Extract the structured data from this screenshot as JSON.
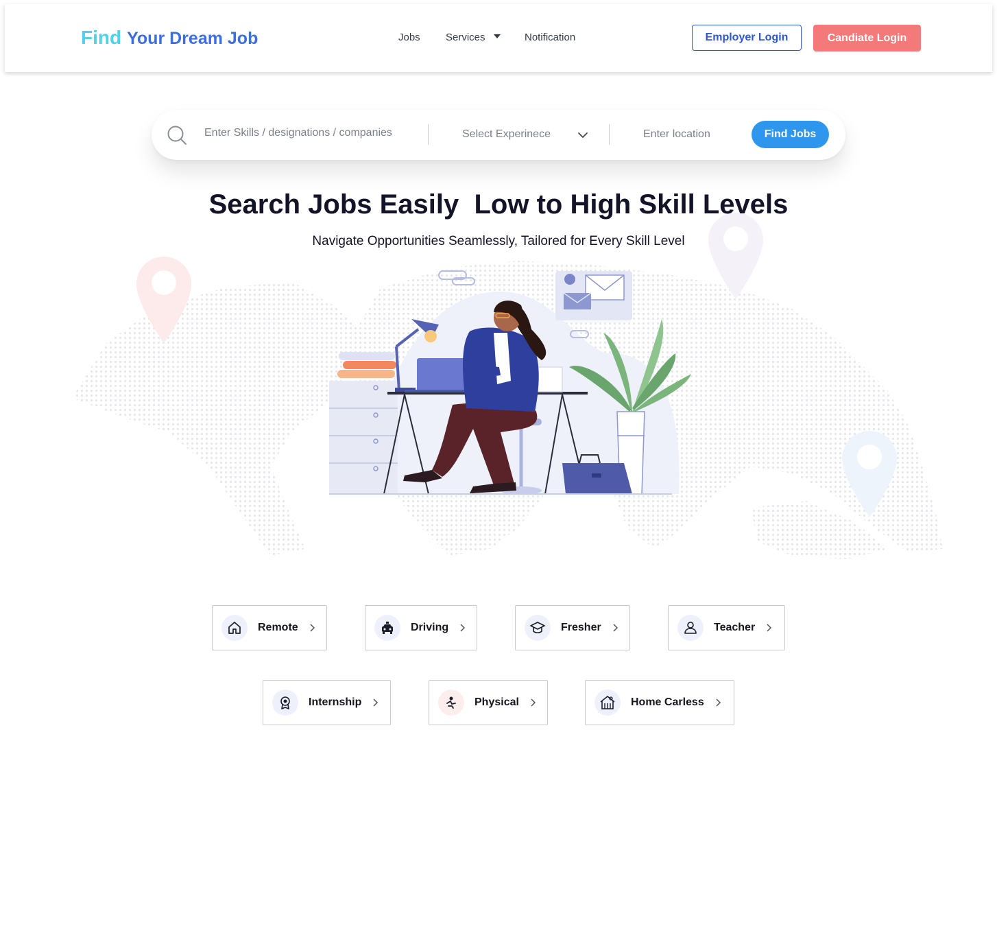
{
  "header": {
    "logo_part1": "Find",
    "logo_part2": "Your Dream Job",
    "nav": {
      "jobs": "Jobs",
      "services": "Services",
      "notification": "Notification"
    },
    "employer_login": "Employer Login",
    "candidate_login": "Candiate Login"
  },
  "search": {
    "skills_placeholder": "Enter Skills / designations / companies",
    "experience_placeholder": "Select Experinece",
    "location_placeholder": "Enter location",
    "find_button": "Find Jobs"
  },
  "hero": {
    "title": "Search Jobs Easily  Low to High Skill Levels",
    "subtitle": "Navigate Opportunities Seamlessly, Tailored for Every Skill Level"
  },
  "categories": [
    {
      "label": "Remote",
      "icon": "home-icon"
    },
    {
      "label": "Driving",
      "icon": "taxi-icon"
    },
    {
      "label": "Fresher",
      "icon": "graduation-cap-icon"
    },
    {
      "label": "Teacher",
      "icon": "user-icon"
    },
    {
      "label": "Internship",
      "icon": "award-badge-icon"
    },
    {
      "label": "Physical",
      "icon": "accessibility-icon"
    },
    {
      "label": "Home Carless",
      "icon": "house-building-icon"
    }
  ],
  "colors": {
    "brand_cyan": "#4fd1e9",
    "brand_blue": "#3b6fe0",
    "employer_blue": "#2f55d4",
    "candidate_coral": "#f47a7a",
    "find_button_blue": "#2f96ee"
  }
}
